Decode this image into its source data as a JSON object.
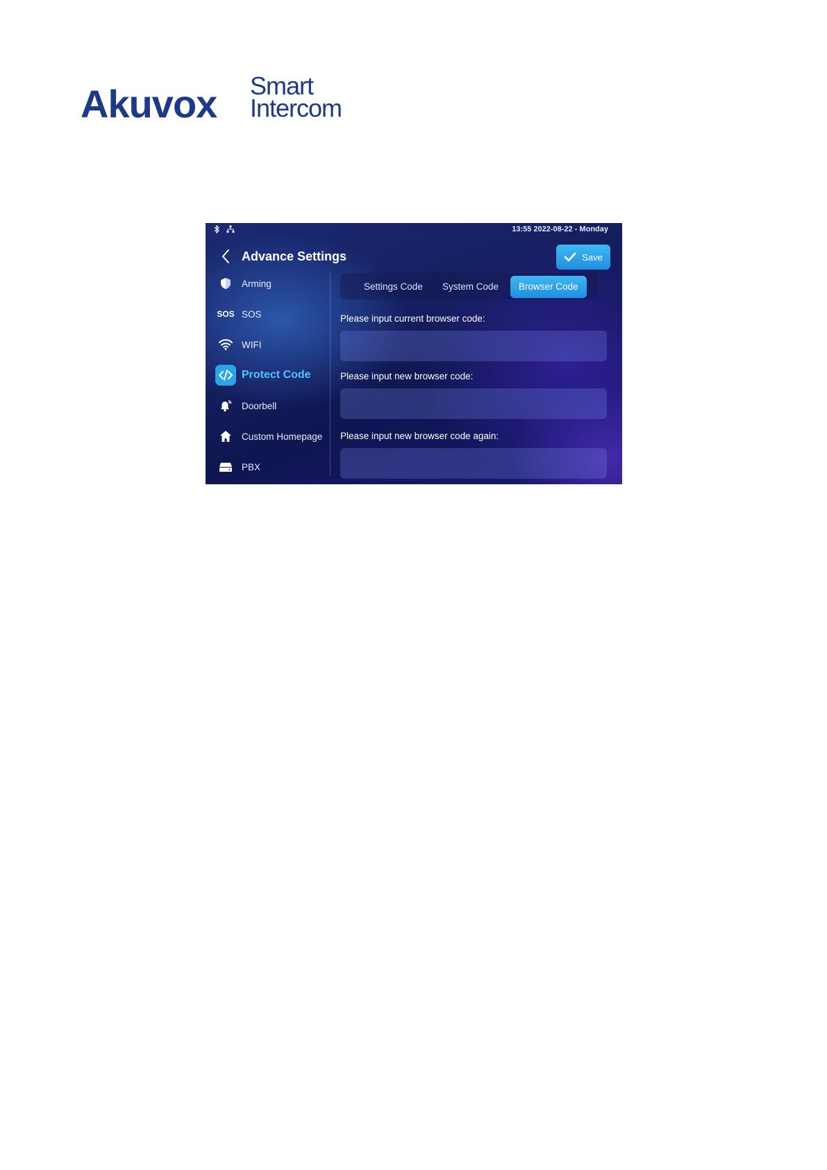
{
  "logo": {
    "main": "Akuvox",
    "sub_line1": "Smart",
    "sub_line2": "Intercom"
  },
  "status_bar": {
    "icons": [
      "bluetooth-icon",
      "network-icon"
    ],
    "datetime": "13:55  2022-08-22 - Monday"
  },
  "header": {
    "title": "Advance Settings",
    "save_label": "Save"
  },
  "sidebar": {
    "items": [
      {
        "label": "Arming",
        "icon": "shield-icon"
      },
      {
        "label": "SOS",
        "icon": "sos-icon",
        "icon_text": "SOS"
      },
      {
        "label": "WIFI",
        "icon": "wifi-icon"
      },
      {
        "label": "Protect Code",
        "icon": "code-icon",
        "active": true
      },
      {
        "label": "Doorbell",
        "icon": "bell-icon"
      },
      {
        "label": "Custom Homepage",
        "icon": "home-icon"
      },
      {
        "label": "PBX",
        "icon": "pbx-icon"
      }
    ]
  },
  "tabs": [
    {
      "label": "Settings Code"
    },
    {
      "label": "System Code"
    },
    {
      "label": "Browser Code",
      "active": true
    }
  ],
  "fields": [
    {
      "label": "Please input current browser code:",
      "value": ""
    },
    {
      "label": "Please input new browser code:",
      "value": ""
    },
    {
      "label": "Please input new browser code again:",
      "value": ""
    }
  ],
  "colors": {
    "accent": "#2aa5ec",
    "logo": "#1d3a8a"
  }
}
